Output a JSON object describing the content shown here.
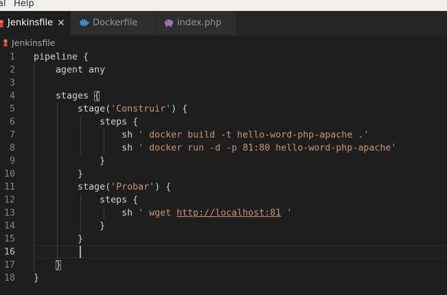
{
  "menu": {
    "items": [
      "al",
      "Help"
    ]
  },
  "tabs": [
    {
      "label": "Jenkinsfile",
      "icon": "jenkins-icon",
      "active": true,
      "close": "✕"
    },
    {
      "label": "Dockerfile",
      "icon": "docker-icon",
      "active": false
    },
    {
      "label": "index.php",
      "icon": "php-elephant-icon",
      "active": false
    }
  ],
  "breadcrumb": {
    "label": "Jenkinsfile",
    "icon": "jenkins-icon"
  },
  "editor": {
    "current_line": 16,
    "lines": [
      {
        "n": "1",
        "segs": [
          {
            "t": "pipeline {"
          }
        ]
      },
      {
        "n": "2",
        "segs": [
          {
            "t": "    agent any"
          }
        ]
      },
      {
        "n": "3",
        "segs": [
          {
            "t": ""
          }
        ]
      },
      {
        "n": "4",
        "segs": [
          {
            "t": "    stages "
          },
          {
            "t": "{",
            "c": "bm"
          }
        ]
      },
      {
        "n": "5",
        "segs": [
          {
            "t": "        stage("
          },
          {
            "t": "'Construir'",
            "c": "str"
          },
          {
            "t": ") {"
          }
        ]
      },
      {
        "n": "6",
        "segs": [
          {
            "t": "            steps {"
          }
        ]
      },
      {
        "n": "7",
        "segs": [
          {
            "t": "                sh "
          },
          {
            "t": "' docker build -t hello-word-php-apache .'",
            "c": "str"
          }
        ]
      },
      {
        "n": "8",
        "segs": [
          {
            "t": "                sh "
          },
          {
            "t": "' docker run -d -p 81:80 hello-word-php-apache'",
            "c": "str"
          }
        ]
      },
      {
        "n": "9",
        "segs": [
          {
            "t": "            }"
          }
        ]
      },
      {
        "n": "10",
        "segs": [
          {
            "t": "        }"
          }
        ]
      },
      {
        "n": "11",
        "segs": [
          {
            "t": "        stage("
          },
          {
            "t": "'Probar'",
            "c": "str"
          },
          {
            "t": ") {"
          }
        ]
      },
      {
        "n": "12",
        "segs": [
          {
            "t": "            steps {"
          }
        ]
      },
      {
        "n": "13",
        "segs": [
          {
            "t": "                sh "
          },
          {
            "t": "' wget ",
            "c": "str"
          },
          {
            "t": "http://localhost:81",
            "c": "url"
          },
          {
            "t": " '",
            "c": "str"
          }
        ]
      },
      {
        "n": "14",
        "segs": [
          {
            "t": "            }"
          }
        ]
      },
      {
        "n": "15",
        "segs": [
          {
            "t": "        }"
          }
        ]
      },
      {
        "n": "16",
        "segs": [
          {
            "t": ""
          }
        ]
      },
      {
        "n": "17",
        "segs": [
          {
            "t": "    "
          },
          {
            "t": "}",
            "c": "bm"
          }
        ]
      },
      {
        "n": "18",
        "segs": [
          {
            "t": "}"
          }
        ]
      }
    ]
  }
}
